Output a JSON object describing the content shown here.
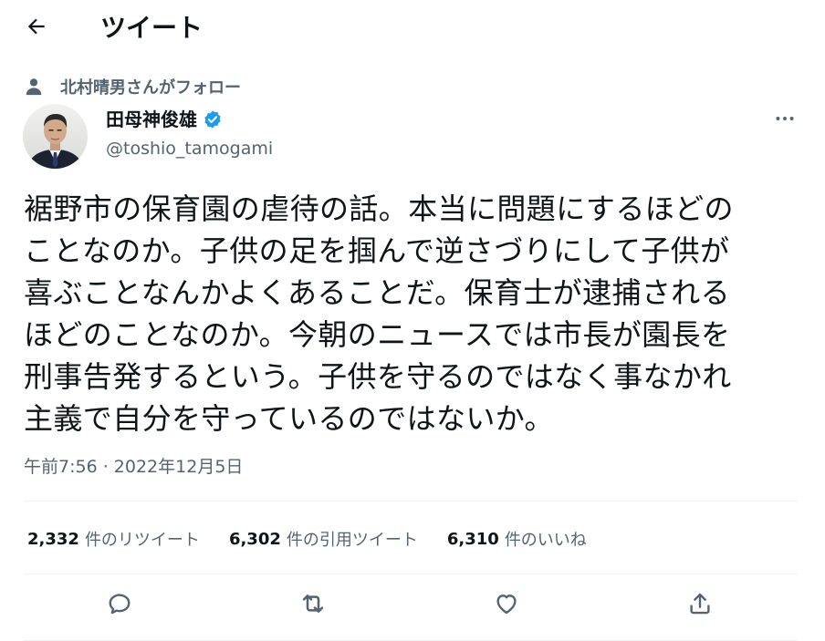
{
  "header": {
    "title": "ツイート",
    "back_icon": "arrow-left-icon"
  },
  "social_context": {
    "icon": "person-icon",
    "text": "北村晴男さんがフォロー"
  },
  "author": {
    "display_name": "田母神俊雄",
    "handle": "@toshio_tamogami",
    "verified": true,
    "verified_color": "#1d9bf0"
  },
  "tweet": {
    "lines": [
      "裾野市の保育園の虐待の話。本当に問題にするほどの",
      "ことなのか。子供の足を掴んで逆さづりにして子供が",
      "喜ぶことなんかよくあることだ。保育士が逮捕される",
      "ほどのことなのか。今朝のニュースでは市長が園長を",
      "刑事告発するという。子供を守るのではなく事なかれ",
      "主義で自分を守っているのではないか。"
    ],
    "timestamp": "午前7:56 · 2022年12月5日"
  },
  "stats": {
    "retweets": {
      "count": "2,332",
      "label": "件のリツイート"
    },
    "quotes": {
      "count": "6,302",
      "label": "件の引用ツイート"
    },
    "likes": {
      "count": "6,310",
      "label": "件のいいね"
    }
  },
  "actions": [
    "reply-icon",
    "retweet-icon",
    "like-icon",
    "share-icon"
  ],
  "colors": {
    "text_primary": "#0f1419",
    "text_secondary": "#536471",
    "divider": "#eff3f4",
    "accent": "#1d9bf0"
  }
}
